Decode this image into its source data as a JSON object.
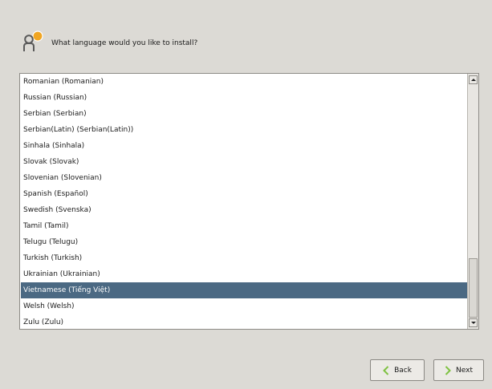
{
  "header": {
    "title": "What language would you like to install?",
    "icon": "people-icon"
  },
  "languages": {
    "items": [
      "Romanian (Romanian)",
      "Russian (Russian)",
      "Serbian (Serbian)",
      "Serbian(Latin) (Serbian(Latin))",
      "Sinhala (Sinhala)",
      "Slovak (Slovak)",
      "Slovenian (Slovenian)",
      "Spanish (Español)",
      "Swedish (Svenska)",
      "Tamil (Tamil)",
      "Telugu (Telugu)",
      "Turkish (Turkish)",
      "Ukrainian (Ukrainian)",
      "Vietnamese (Tiếng Việt)",
      "Welsh (Welsh)",
      "Zulu (Zulu)"
    ],
    "selected": "Vietnamese (Tiếng Việt)"
  },
  "buttons": {
    "back_label": "Back",
    "next_label": "Next",
    "back_icon": "chevron-left-icon",
    "next_icon": "chevron-right-icon"
  },
  "colors": {
    "background": "#dcdad5",
    "selection": "#4b6983",
    "arrow_green": "#7fc242",
    "icon_orange": "#f0a522"
  }
}
